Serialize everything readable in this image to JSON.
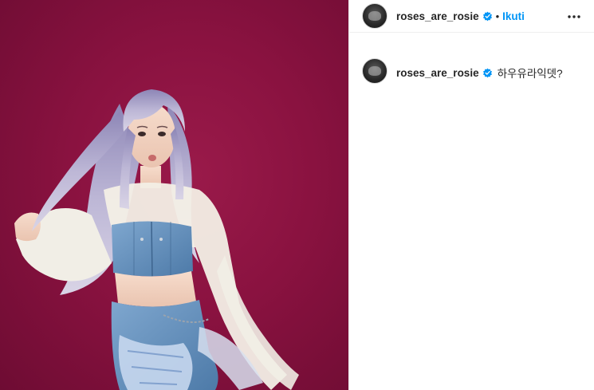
{
  "post": {
    "photo": {
      "alt_icon": "photo-of-person"
    },
    "header": {
      "username": "roses_are_rosie",
      "verified_icon": "verified-badge-icon",
      "separator": "•",
      "follow_label": "Ikuti",
      "more_icon": "more-options-icon"
    },
    "caption": {
      "username": "roses_are_rosie",
      "text": "하우유라익뎃?"
    },
    "colors": {
      "accent": "#0095f6",
      "background": "#ffffff",
      "photo_background": "#8a1240"
    }
  }
}
